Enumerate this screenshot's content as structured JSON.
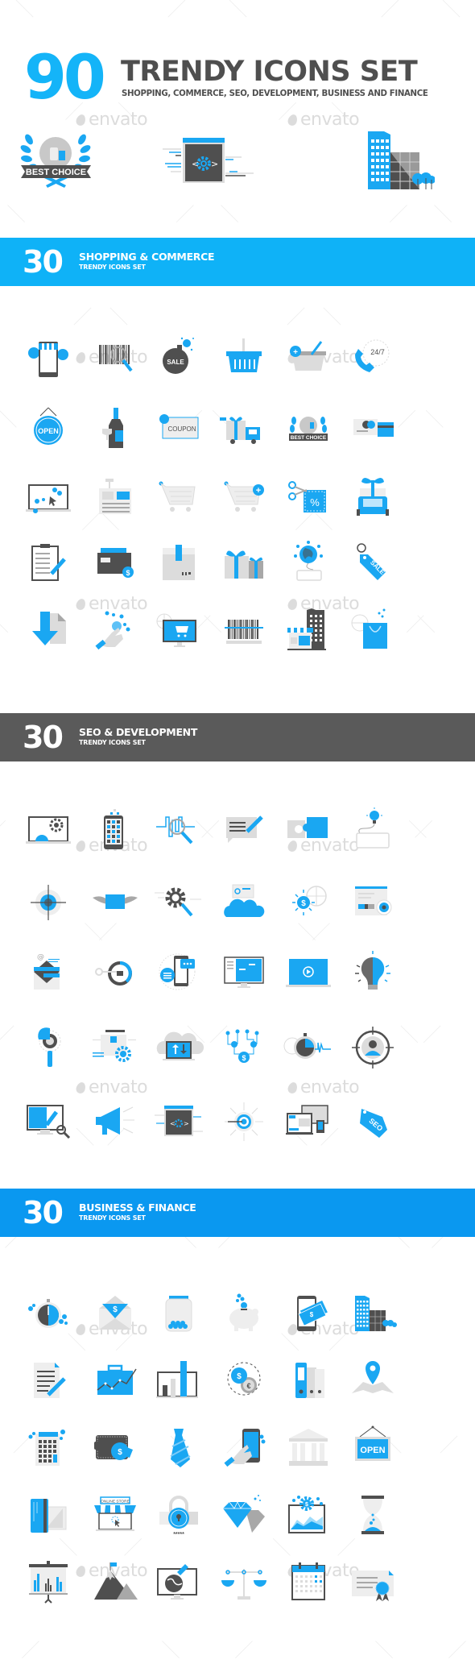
{
  "header": {
    "number": "90",
    "title": "TRENDY ICONS SET",
    "subtitle": "SHOPPING, COMMERCE, SEO, DEVELOPMENT, BUSINESS AND FINANCE"
  },
  "hero_icons": [
    {
      "name": "best-choice-badge-icon",
      "label": "BEST CHOICE"
    },
    {
      "name": "code-window-icon",
      "label": "< >"
    },
    {
      "name": "office-buildings-icon"
    }
  ],
  "watermark": "envato",
  "colors": {
    "accent": "#14b4f8",
    "banner_shopping": "#0fb2f7",
    "banner_seo": "#5a5a5a",
    "banner_business": "#0a98f0",
    "dark_gray": "#4f4f4f",
    "light_gray": "#e6e6e6"
  },
  "sections": [
    {
      "id": "shopping",
      "count": "30",
      "title": "SHOPPING & COMMERCE",
      "subtitle": "TRENDY ICONS SET",
      "icons": [
        {
          "name": "mobile-store-icon"
        },
        {
          "name": "barcode-search-icon"
        },
        {
          "name": "sale-bomb-icon",
          "label": "SALE"
        },
        {
          "name": "shopping-basket-icon"
        },
        {
          "name": "add-to-basket-icon"
        },
        {
          "name": "support-24-7-icon",
          "label": "24/7"
        },
        {
          "name": "open-sign-icon",
          "label": "OPEN"
        },
        {
          "name": "wine-bottle-icon"
        },
        {
          "name": "coupon-icon",
          "label": "COUPON"
        },
        {
          "name": "gift-delivery-truck-icon"
        },
        {
          "name": "best-choice-icon",
          "label": "BEST CHOICE"
        },
        {
          "name": "payment-cards-icon"
        },
        {
          "name": "online-click-monitor-icon"
        },
        {
          "name": "cash-register-icon"
        },
        {
          "name": "shopping-cart-icon"
        },
        {
          "name": "add-to-cart-icon"
        },
        {
          "name": "discount-coupon-cut-icon",
          "label": "%"
        },
        {
          "name": "gift-van-icon"
        },
        {
          "name": "checklist-icon"
        },
        {
          "name": "wallet-cash-icon"
        },
        {
          "name": "package-box-icon"
        },
        {
          "name": "gift-boxes-icon"
        },
        {
          "name": "global-online-shopping-icon"
        },
        {
          "name": "sale-tag-icon",
          "label": "SALE"
        },
        {
          "name": "download-arrow-icon"
        },
        {
          "name": "touch-hand-icon"
        },
        {
          "name": "online-cart-monitor-icon"
        },
        {
          "name": "barcode-scan-icon"
        },
        {
          "name": "store-building-icon"
        },
        {
          "name": "shopping-bag-icon"
        }
      ]
    },
    {
      "id": "seo",
      "count": "30",
      "title": "SEO & DEVELOPMENT",
      "subtitle": "TRENDY ICONS SET",
      "icons": [
        {
          "name": "laptop-settings-icon"
        },
        {
          "name": "mobile-apps-icon"
        },
        {
          "name": "analytics-search-icon"
        },
        {
          "name": "write-comment-icon"
        },
        {
          "name": "puzzle-icon"
        },
        {
          "name": "idea-keyboard-icon"
        },
        {
          "name": "target-crosshair-icon"
        },
        {
          "name": "winged-mail-icon"
        },
        {
          "name": "gear-search-icon"
        },
        {
          "name": "cloud-data-icon"
        },
        {
          "name": "money-globe-icon",
          "label": "$"
        },
        {
          "name": "web-view-eye-icon"
        },
        {
          "name": "email-marketing-icon",
          "label": "@"
        },
        {
          "name": "key-lock-progress-icon"
        },
        {
          "name": "mobile-chat-icon"
        },
        {
          "name": "web-monitor-icon"
        },
        {
          "name": "video-laptop-icon"
        },
        {
          "name": "brain-bulb-icon"
        },
        {
          "name": "pie-chart-search-icon"
        },
        {
          "name": "web-development-gear-icon"
        },
        {
          "name": "cloud-transfer-icon"
        },
        {
          "name": "network-money-icon",
          "label": "$"
        },
        {
          "name": "stopwatch-speed-icon"
        },
        {
          "name": "target-user-icon"
        },
        {
          "name": "web-design-monitor-icon"
        },
        {
          "name": "megaphone-icon"
        },
        {
          "name": "code-window-icon",
          "label": "< >"
        },
        {
          "name": "bullseye-target-icon"
        },
        {
          "name": "responsive-devices-icon"
        },
        {
          "name": "seo-tag-icon",
          "label": "SEO"
        }
      ]
    },
    {
      "id": "business",
      "count": "30",
      "title": "BUSINESS & FINANCE",
      "subtitle": "TRENDY ICONS SET",
      "icons": [
        {
          "name": "stopwatch-icon"
        },
        {
          "name": "money-envelope-icon",
          "label": "$"
        },
        {
          "name": "coin-jar-icon"
        },
        {
          "name": "piggy-bank-icon"
        },
        {
          "name": "mobile-payment-icon",
          "label": "$"
        },
        {
          "name": "office-buildings-icon"
        },
        {
          "name": "contract-sign-icon"
        },
        {
          "name": "briefcase-growth-icon"
        },
        {
          "name": "bar-chart-icon"
        },
        {
          "name": "currency-exchange-icon",
          "label": "$"
        },
        {
          "name": "binders-icon"
        },
        {
          "name": "map-location-icon"
        },
        {
          "name": "calculator-icon"
        },
        {
          "name": "wallet-coin-icon",
          "label": "$"
        },
        {
          "name": "necktie-icon"
        },
        {
          "name": "touch-phone-icon"
        },
        {
          "name": "bank-building-icon"
        },
        {
          "name": "open-sign-board-icon",
          "label": "OPEN"
        },
        {
          "name": "credit-card-icon"
        },
        {
          "name": "online-store-icon",
          "label": "ONLINE STORE"
        },
        {
          "name": "padlock-password-icon",
          "label": "*****"
        },
        {
          "name": "diamonds-icon"
        },
        {
          "name": "financial-tablet-icon",
          "label": "$"
        },
        {
          "name": "hourglass-icon"
        },
        {
          "name": "presentation-board-icon"
        },
        {
          "name": "mountain-flag-icon"
        },
        {
          "name": "global-business-monitor-icon"
        },
        {
          "name": "balance-scale-icon"
        },
        {
          "name": "calendar-icon"
        },
        {
          "name": "certificate-icon"
        }
      ]
    }
  ]
}
